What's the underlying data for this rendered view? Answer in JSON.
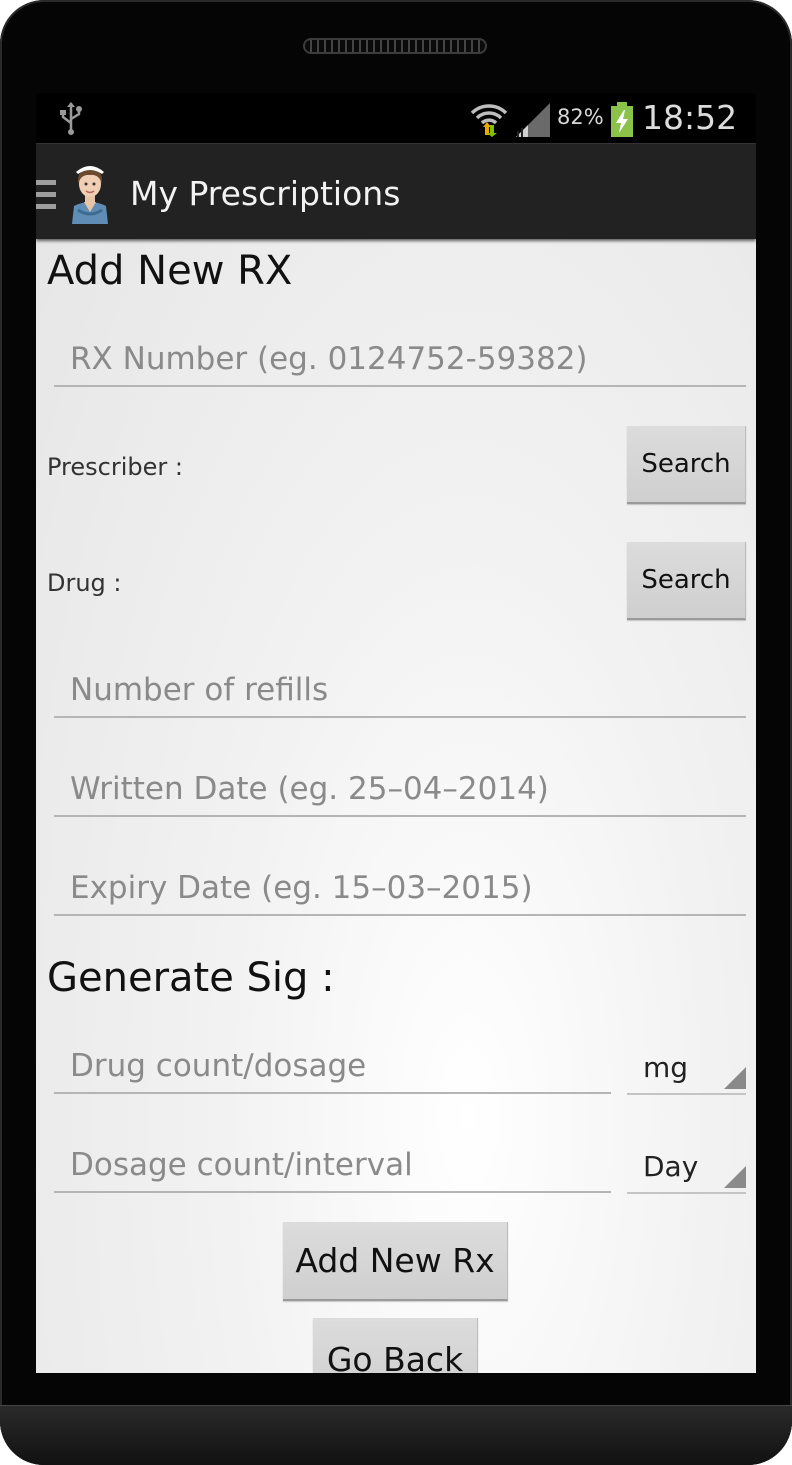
{
  "status_bar": {
    "battery_percent": "82%",
    "time": "18:52",
    "icons": [
      "usb-icon",
      "wifi-icon",
      "signal-icon",
      "battery-charging-icon"
    ]
  },
  "action_bar": {
    "title": "My Prescriptions",
    "icons": [
      "menu-icon",
      "nurse-avatar-icon"
    ]
  },
  "form": {
    "heading": "Add New RX",
    "rx_number_placeholder": "RX Number (eg. 0124752-59382)",
    "prescriber_label": "Prescriber :",
    "prescriber_search_label": "Search",
    "drug_label": "Drug :",
    "drug_search_label": "Search",
    "refills_placeholder": "Number of refills",
    "written_date_placeholder": "Written Date (eg. 25–04–2014)",
    "expiry_date_placeholder": "Expiry Date (eg. 15–03–2015)"
  },
  "sig": {
    "heading": "Generate Sig :",
    "dosage_placeholder": "Drug count/dosage",
    "dosage_unit": "mg",
    "interval_placeholder": "Dosage count/interval",
    "interval_unit": "Day"
  },
  "actions": {
    "add_label": "Add New Rx",
    "back_label": "Go Back"
  }
}
